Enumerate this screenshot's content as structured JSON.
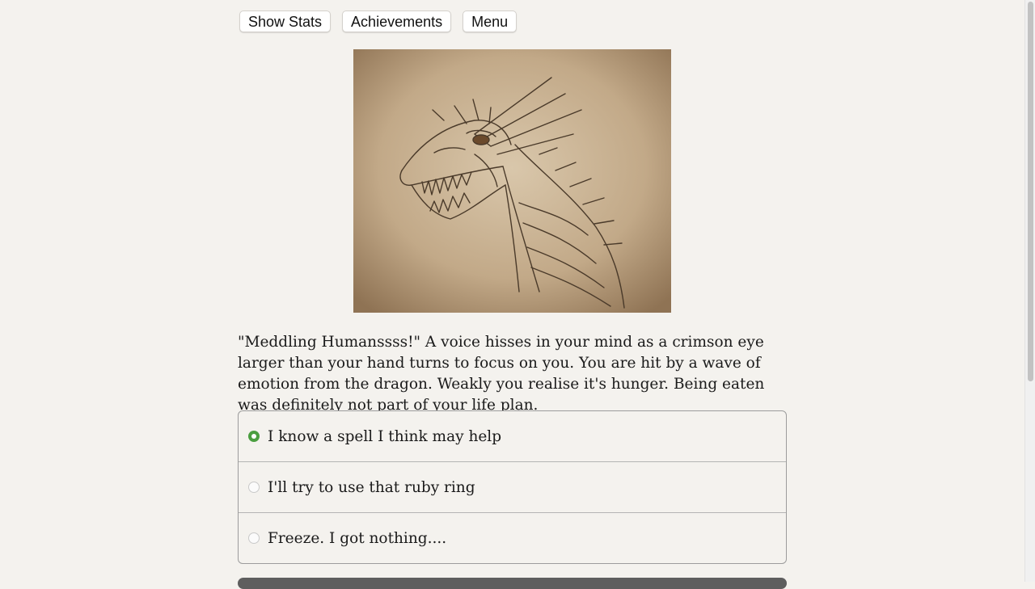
{
  "toolbar": {
    "show_stats": "Show Stats",
    "achievements": "Achievements",
    "menu": "Menu"
  },
  "scene": {
    "image_icon": "dragon-head-sketch",
    "story_text": "\"Meddling Humanssss!\" A voice hisses in your mind as a crimson eye larger than your hand turns to focus on you. You are hit by a wave of emotion from the dragon. Weakly you realise it's hunger. Being eaten was definitely not part of your life plan."
  },
  "choices": [
    {
      "label": "I know a spell I think may help",
      "selected": true
    },
    {
      "label": "I'll try to use that ruby ring",
      "selected": false
    },
    {
      "label": "Freeze. I got nothing....",
      "selected": false
    }
  ],
  "colors": {
    "page_bg": "#f4f2ee",
    "radio_selected": "#4a9e3f",
    "next_button": "#5e5e5e"
  }
}
